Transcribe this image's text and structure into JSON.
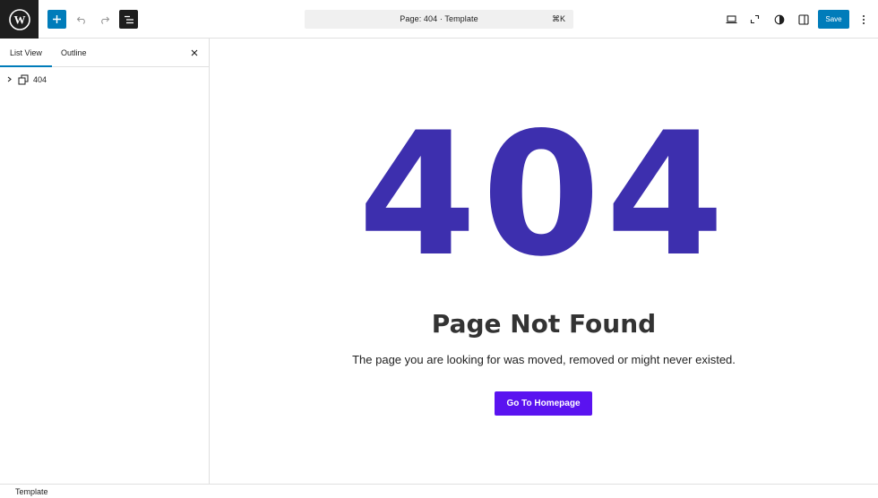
{
  "toolbar": {
    "logo_icon": "wordpress-logo-icon",
    "add_icon": "plus-icon",
    "undo_icon": "undo-icon",
    "redo_icon": "redo-icon",
    "list_view_icon": "list-view-icon",
    "command_bar": {
      "title": "Page: 404 · Template",
      "shortcut": "⌘K"
    },
    "preview_icon": "desktop-icon",
    "expand_icon": "expand-icon",
    "styles_icon": "half-circle-icon",
    "settings_icon": "sidebar-icon",
    "save_label": "Save",
    "options_icon": "vertical-ellipsis-icon"
  },
  "sidebar": {
    "tabs": [
      {
        "label": "List View",
        "active": true
      },
      {
        "label": "Outline",
        "active": false
      }
    ],
    "close_icon": "close-icon",
    "tree": [
      {
        "label": "404",
        "icon": "template-part-icon",
        "expanded": false
      }
    ]
  },
  "canvas": {
    "big_number": "404",
    "title": "Page Not Found",
    "message": "The page you are looking for was moved, removed or might never existed.",
    "button_label": "Go To Homepage"
  },
  "footer": {
    "breadcrumb": "Template"
  },
  "colors": {
    "accent": "#007cba",
    "heading_purple": "#3d2fae",
    "button_purple": "#5a13f0",
    "dark": "#1e1e1e"
  }
}
